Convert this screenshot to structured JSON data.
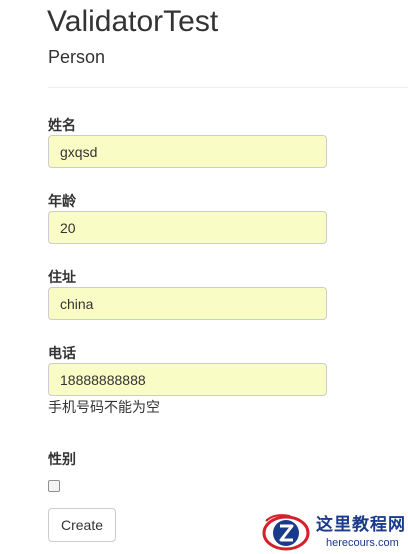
{
  "header": {
    "title": "ValidatorTest",
    "subtitle": "Person"
  },
  "form": {
    "name_label": "姓名",
    "name_value": "gxqsd",
    "age_label": "年龄",
    "age_value": "20",
    "address_label": "住址",
    "address_value": "china",
    "phone_label": "电话",
    "phone_value": "18888888888",
    "phone_error": "手机号码不能为空",
    "gender_label": "性别",
    "gender_checked": false,
    "create_label": "Create"
  },
  "watermark": {
    "site_name": "这里教程网",
    "site_url": "herecours.com"
  },
  "colors": {
    "input_bg": "#fafcc6",
    "watermark_blue": "#1a3a8a",
    "watermark_red": "#d4202a"
  }
}
